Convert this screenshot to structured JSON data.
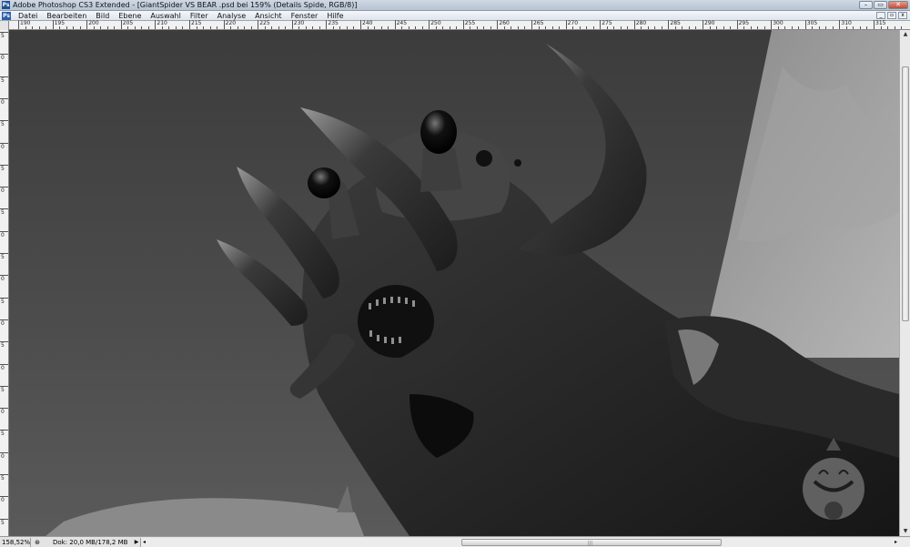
{
  "window": {
    "title": "Adobe Photoshop CS3 Extended - [GiantSpider VS BEAR .psd bei 159% (Details Spide, RGB/8)]",
    "app_icon_label": "Ps",
    "controls": {
      "minimize": "–",
      "maximize": "▭",
      "close": "✕"
    }
  },
  "menubar": {
    "logo_label": "Ps",
    "items": [
      "Datei",
      "Bearbeiten",
      "Bild",
      "Ebene",
      "Auswahl",
      "Filter",
      "Analyse",
      "Ansicht",
      "Fenster",
      "Hilfe"
    ],
    "doc_controls": {
      "minimize": "_",
      "restore": "▫",
      "close": "x"
    }
  },
  "ruler": {
    "top_labels": [
      "190",
      "195",
      "200",
      "205",
      "210",
      "215",
      "220",
      "225",
      "230",
      "235",
      "240",
      "245",
      "250",
      "255",
      "260",
      "265",
      "270",
      "275",
      "280",
      "285",
      "290",
      "295",
      "300",
      "305",
      "310",
      "315"
    ],
    "left_labels": [
      "5",
      "0",
      "5",
      "0",
      "5",
      "0",
      "5",
      "0",
      "5",
      "0",
      "5",
      "0",
      "5",
      "0",
      "5",
      "0",
      "5",
      "0",
      "5",
      "0",
      "5",
      "0",
      "5"
    ]
  },
  "statusbar": {
    "zoom": "158,52%",
    "doc_info": "Dok: 20,0 MB/178,2 MB",
    "doc_icon": "⊛",
    "arrow_right": "▶",
    "arrow_left": "◂",
    "arrow_right_end": "▸",
    "grip": "|||"
  },
  "scrollbar": {
    "up": "▲",
    "down": "▼"
  },
  "colors": {
    "titlebar": "#c4cfdc",
    "menubar": "#e8ecf1",
    "canvas_bg": "#4a4a4a",
    "ruler": "#f1f1f1"
  },
  "icons": {
    "app": "photoshop-icon",
    "doc_info": "document-info-icon"
  }
}
